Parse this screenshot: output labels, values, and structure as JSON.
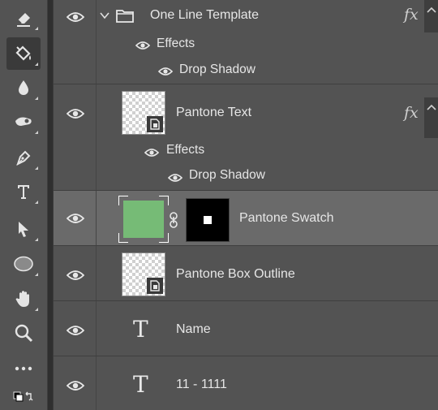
{
  "colors": {
    "swatch": "#76bb76",
    "mask": "#000000",
    "selected_row": "#6a6a6a"
  },
  "toolbar": {
    "tools": [
      {
        "name": "eraser-icon"
      },
      {
        "name": "paint-bucket-icon",
        "selected": true
      },
      {
        "name": "blur-drop-icon"
      },
      {
        "name": "smudge-icon"
      },
      {
        "name": "pen-tool-icon"
      },
      {
        "name": "type-tool-icon"
      },
      {
        "name": "path-selection-icon"
      },
      {
        "name": "ellipse-tool-icon"
      },
      {
        "name": "hand-tool-icon"
      },
      {
        "name": "zoom-tool-icon"
      },
      {
        "name": "more-tools-icon"
      },
      {
        "name": "default-colors-icon"
      }
    ]
  },
  "layers": {
    "group": {
      "name": "One Line Template",
      "fx": "fx",
      "effects_label": "Effects",
      "effect": "Drop Shadow"
    },
    "pantone_text": {
      "name": "Pantone Text",
      "fx": "fx",
      "effects_label": "Effects",
      "effect": "Drop Shadow"
    },
    "pantone_swatch": {
      "name": "Pantone Swatch"
    },
    "pantone_box_outline": {
      "name": "Pantone Box Outline"
    },
    "name_layer": {
      "name": "Name",
      "type_glyph": "T"
    },
    "number_layer": {
      "name": "11 - 1111",
      "type_glyph": "T"
    }
  }
}
